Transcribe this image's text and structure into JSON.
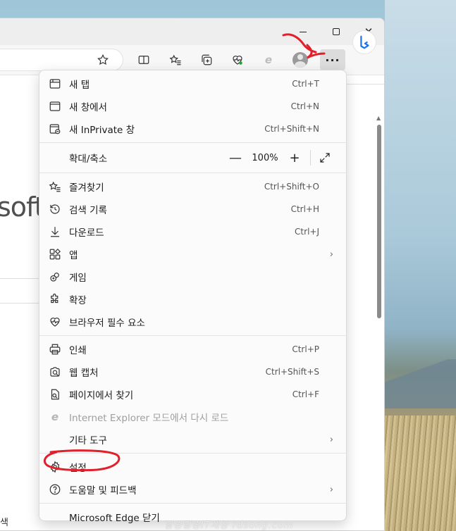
{
  "window": {
    "minimize_icon": "minimize-icon",
    "maximize_icon": "maximize-icon",
    "close_icon": "close-icon"
  },
  "page": {
    "brand_fragment": "soft",
    "search_fragment": "색"
  },
  "menu": {
    "items": [
      {
        "label": "새 탭",
        "shortcut": "Ctrl+T",
        "icon": "new-tab-icon"
      },
      {
        "label": "새 창에서",
        "shortcut": "Ctrl+N",
        "icon": "new-window-icon"
      },
      {
        "label": "새 InPrivate 창",
        "shortcut": "Ctrl+Shift+N",
        "icon": "inprivate-icon"
      },
      {
        "label": "확대/축소",
        "value": "100%",
        "icon": ""
      },
      {
        "label": "즐겨찾기",
        "shortcut": "Ctrl+Shift+O",
        "icon": "favorites-icon"
      },
      {
        "label": "검색 기록",
        "shortcut": "Ctrl+H",
        "icon": "history-icon"
      },
      {
        "label": "다운로드",
        "shortcut": "Ctrl+J",
        "icon": "download-icon"
      },
      {
        "label": "앱",
        "icon": "apps-icon"
      },
      {
        "label": "게임",
        "icon": "games-icon"
      },
      {
        "label": "확장",
        "icon": "extensions-icon"
      },
      {
        "label": "브라우저 필수 요소",
        "icon": "browser-essentials-icon"
      },
      {
        "label": "인쇄",
        "shortcut": "Ctrl+P",
        "icon": "print-icon"
      },
      {
        "label": "웹 캡처",
        "shortcut": "Ctrl+Shift+S",
        "icon": "web-capture-icon"
      },
      {
        "label": "페이지에서 찾기",
        "shortcut": "Ctrl+F",
        "icon": "find-icon"
      },
      {
        "label": "Internet Explorer 모드에서 다시 로드",
        "icon": "ie-mode-icon",
        "disabled": true
      },
      {
        "label": "기타 도구",
        "icon": ""
      },
      {
        "label": "설정",
        "icon": "settings-icon"
      },
      {
        "label": "도움말 및 피드백",
        "icon": "help-icon"
      },
      {
        "label": "Microsoft Edge 닫기",
        "icon": ""
      }
    ]
  },
  "watermark": "알송달송IT세상 rdsong.com",
  "colors": {
    "annotation_red": "#e0202a",
    "menu_bg": "#fbfbfb",
    "more_button_bg": "#dcdcdc"
  }
}
